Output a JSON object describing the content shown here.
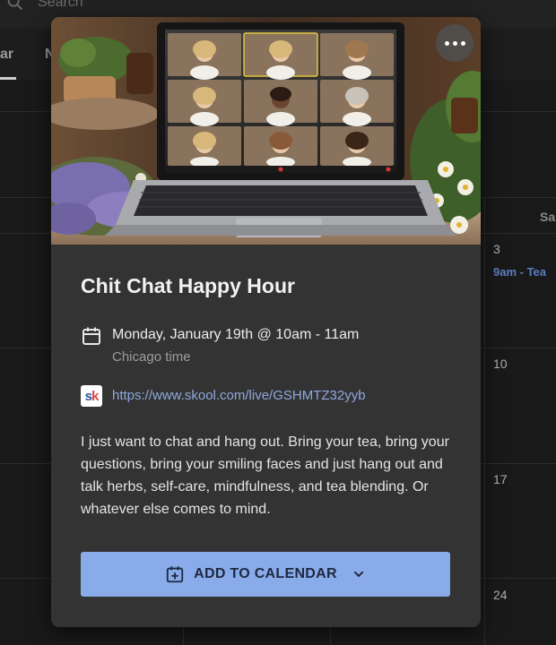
{
  "background": {
    "search_placeholder": "Search",
    "tab_partial_1": "ar",
    "tab_partial_2": "N",
    "weekday_partial": "Sa",
    "days": [
      "3",
      "10",
      "17",
      "24"
    ],
    "event_label": "9am - Tea"
  },
  "event": {
    "title": "Chit Chat Happy Hour",
    "date_line": "Monday, January 19th @ 10am - 11am",
    "timezone": "Chicago time",
    "link": "https://www.skool.com/live/GSHMTZ32yyb",
    "description": "I just want to chat and hang out. Bring your tea, bring your questions, bring your smiling faces and just hang out and talk herbs, self-care, mindfulness, and tea blending. Or whatever else comes to mind.",
    "add_to_calendar_label": "ADD TO CALENDAR"
  },
  "icons": {
    "more": "more-horizontal-icon",
    "calendar": "calendar-icon",
    "skool": "skool-logo-icon",
    "calendar_add": "calendar-add-icon",
    "chevron": "chevron-down-icon"
  },
  "colors": {
    "modal_bg": "#333333",
    "button_bg": "#8aabe9",
    "link": "#8fa9e0",
    "event_blue": "#5d7dc1"
  }
}
